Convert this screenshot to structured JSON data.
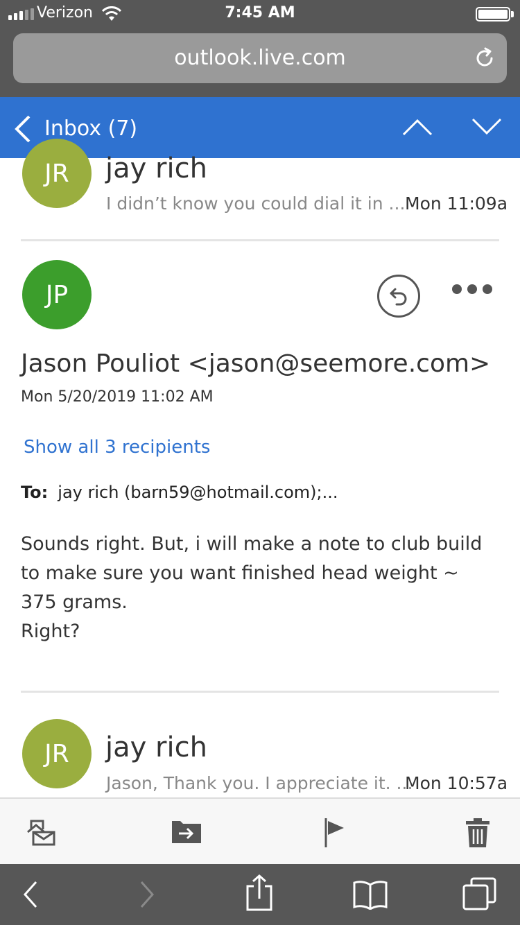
{
  "status_bar": {
    "carrier": "Verizon",
    "time": "7:45 AM",
    "signal_bars_filled": 3,
    "signal_bars_total": 5
  },
  "browser": {
    "url": "outlook.live.com",
    "reload_icon": "reload-icon"
  },
  "header": {
    "back_label": "Inbox (7)",
    "back_icon": "chevron-left-icon",
    "prev_icon": "chevron-up-icon",
    "next_icon": "chevron-down-icon",
    "color": "#2f72d0"
  },
  "messages": [
    {
      "initials": "JR",
      "avatar_color": "#9aae3f",
      "sender": "jay rich",
      "preview": "I didn’t know you could dial it in ...",
      "date": "Mon 11:09a"
    },
    {
      "initials": "JP",
      "avatar_color": "#3c9e2c",
      "from": "Jason Pouliot <jason@seemore.com>",
      "sent": "Mon 5/20/2019 11:02 AM",
      "show_recipients": "Show all 3 recipients",
      "to_label": "To:",
      "to_value": "jay rich (barn59@hotmail.com);...",
      "body": [
        "Sounds right.  But, i will make a note to club build to make sure you want finished head weight ~ 375 grams.",
        "Right?"
      ],
      "reply_icon": "reply-icon",
      "more_icon": "more-icon"
    },
    {
      "initials": "JR",
      "avatar_color": "#9aae3f",
      "sender": "jay rich",
      "preview": "Jason, Thank you. I appreciate it. ...",
      "date": "Mon 10:57a"
    }
  ],
  "action_bar": {
    "icons": [
      "mark-read-icon",
      "move-icon",
      "flag-icon",
      "trash-icon"
    ]
  },
  "safari_bar": {
    "icons": [
      "back-icon",
      "forward-icon",
      "share-icon",
      "bookmarks-icon",
      "tabs-icon"
    ]
  }
}
